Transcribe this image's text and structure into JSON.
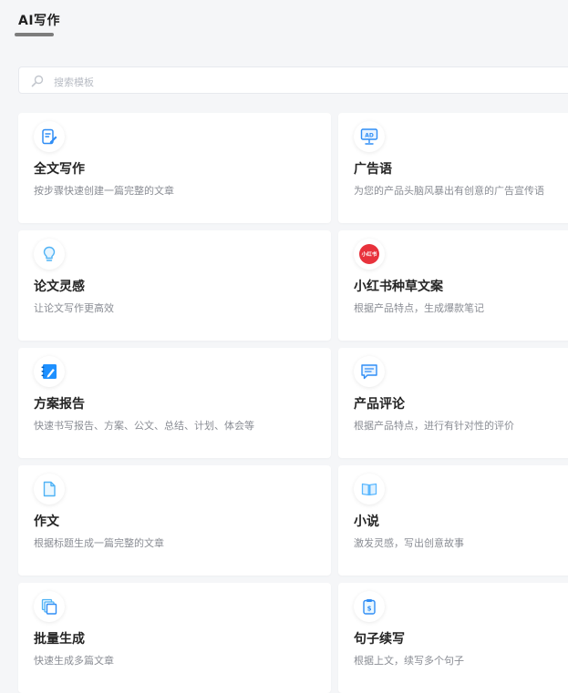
{
  "header": {
    "title": "AI写作"
  },
  "search": {
    "placeholder": "搜索模板"
  },
  "cards": [
    {
      "title": "全文写作",
      "desc": "按步骤快速创建一篇完整的文章",
      "icon": "edit-document-icon"
    },
    {
      "title": "广告语",
      "desc": "为您的产品头脑风暴出有创意的广告宣传语",
      "icon": "ad-billboard-icon"
    },
    {
      "title": "论文灵感",
      "desc": "让论文写作更高效",
      "icon": "lightbulb-icon"
    },
    {
      "title": "小红书种草文案",
      "desc": "根据产品特点，生成爆款笔记",
      "icon": "xiaohongshu-logo-icon",
      "logo_text": "小红书"
    },
    {
      "title": "方案报告",
      "desc": "快速书写报告、方案、公文、总结、计划、体会等",
      "icon": "notebook-pen-icon"
    },
    {
      "title": "产品评论",
      "desc": "根据产品特点，进行有针对性的评价",
      "icon": "comment-bubble-icon"
    },
    {
      "title": "作文",
      "desc": "根据标题生成一篇完整的文章",
      "icon": "document-icon"
    },
    {
      "title": "小说",
      "desc": "激发灵感，写出创意故事",
      "icon": "open-book-icon"
    },
    {
      "title": "批量生成",
      "desc": "快速生成多篇文章",
      "icon": "stacked-pages-icon"
    },
    {
      "title": "句子续写",
      "desc": "根据上文，续写多个句子",
      "icon": "clipboard-s-icon"
    }
  ],
  "colors": {
    "accent_blue": "#1e90ff",
    "light_blue": "#5bb8ff",
    "xiaohongshu_red": "#e8323c",
    "background": "#f5f6f8"
  }
}
